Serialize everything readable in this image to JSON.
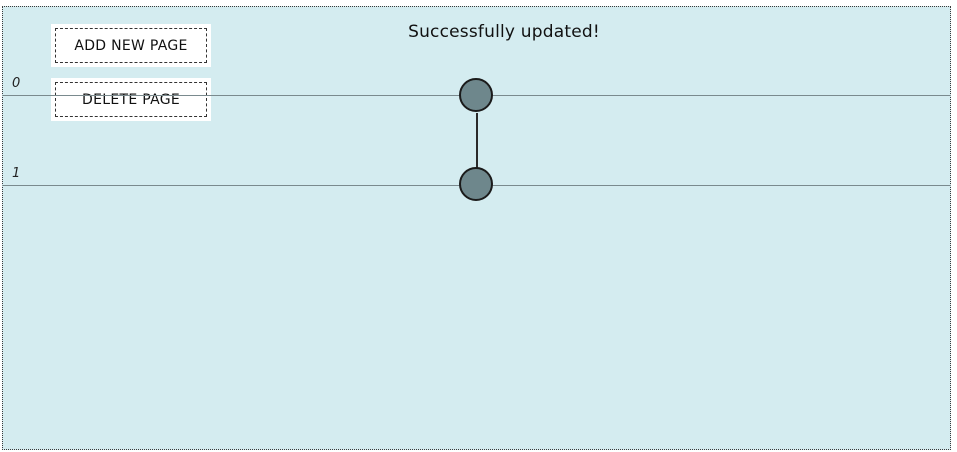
{
  "status": {
    "message": "Successfully updated!"
  },
  "toolbar": {
    "add_label": "ADD NEW PAGE",
    "delete_label": "DELETE PAGE"
  },
  "rows": [
    {
      "label": "0"
    },
    {
      "label": "1"
    }
  ],
  "colors": {
    "canvas_bg": "#d4ecf0",
    "node_fill": "#6e878c",
    "line": "#7a8a8e"
  }
}
